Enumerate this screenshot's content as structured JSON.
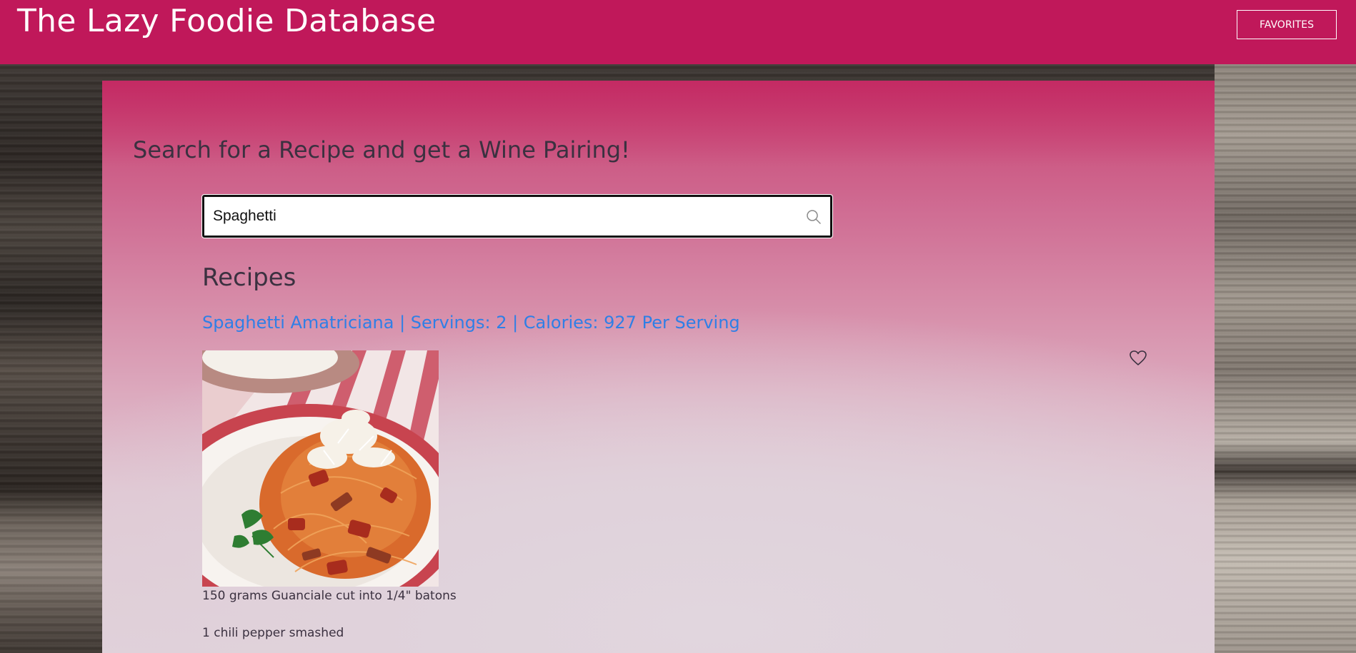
{
  "header": {
    "title": "The Lazy Foodie Database",
    "favorites_label": "FAVORITES",
    "background_color": "#c0185a"
  },
  "search": {
    "heading": "Search for a Recipe and get a Wine Pairing!",
    "value": "Spaghetti",
    "icon": "search-icon"
  },
  "recipes": {
    "heading": "Recipes",
    "items": [
      {
        "title": "Spaghetti Amatriciana | Servings: 2 | Calories: 927 Per Serving",
        "link_color": "#2f7fe6",
        "favorite_icon": "heart-outline-icon",
        "ingredients": [
          "150 grams Guanciale cut into 1/4\" batons",
          "1 chili pepper smashed"
        ]
      }
    ]
  }
}
